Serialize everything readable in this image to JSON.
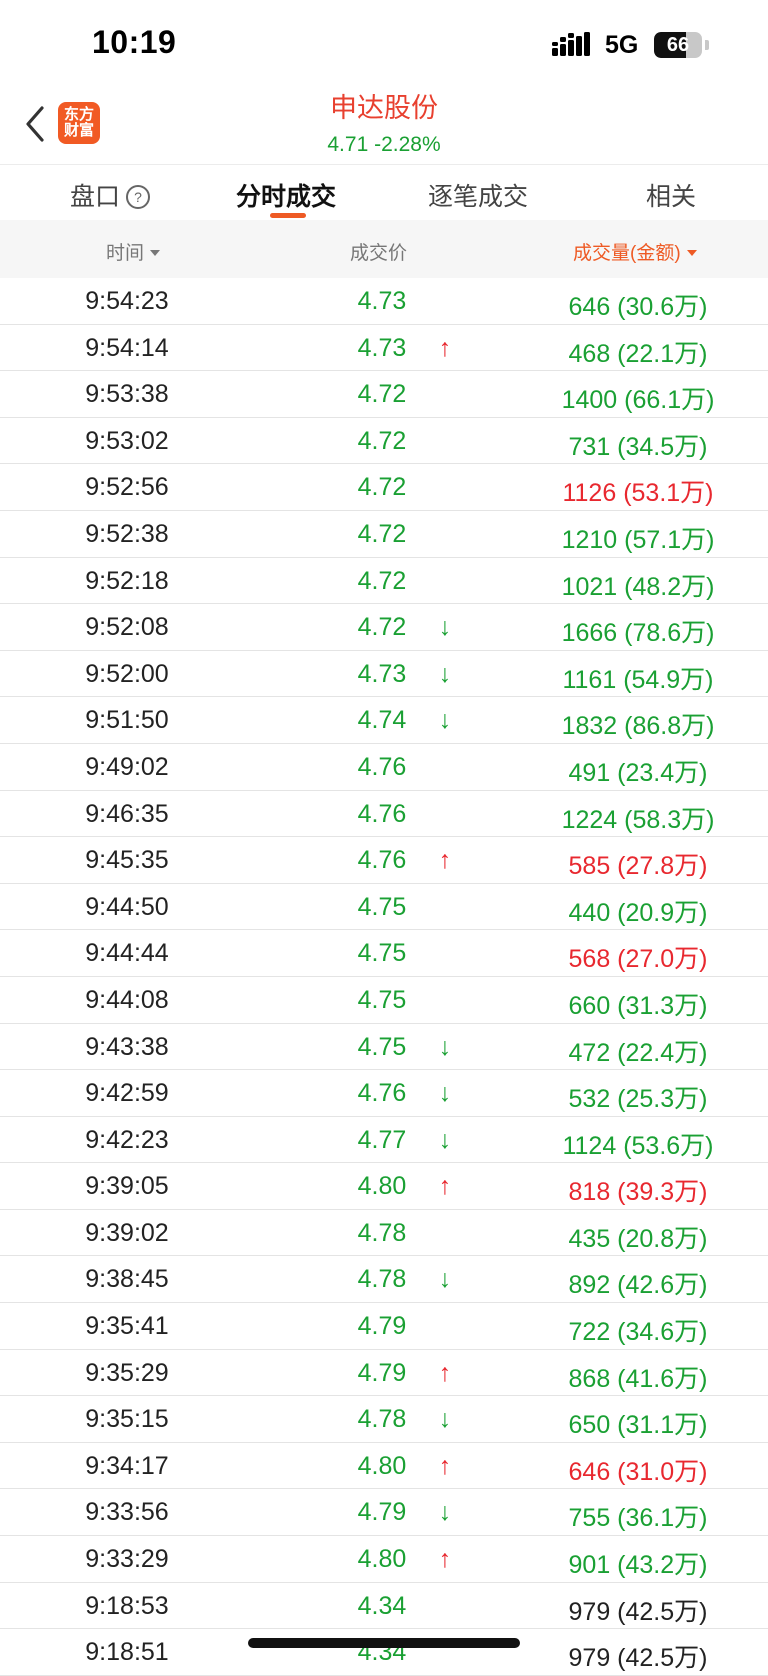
{
  "status": {
    "time": "10:19",
    "network": "5G",
    "battery": "66",
    "battery_level": 0.66
  },
  "header": {
    "logo_line1": "东方",
    "logo_line2": "财富",
    "stock_name": "申达股份",
    "quote": "4.71  -2.28%"
  },
  "tabs": [
    "盘口",
    "分时成交",
    "逐笔成交",
    "相关"
  ],
  "columns": {
    "time": "时间",
    "price": "成交价",
    "volume": "成交量(金额)"
  },
  "colors": {
    "up_red": "#e8282f",
    "down_green": "#1aa033",
    "accent": "#ee5a24"
  },
  "rows": [
    {
      "time": "9:54:23",
      "price": "4.73",
      "arrow": "",
      "volume": "646 (30.6万)",
      "color": "green"
    },
    {
      "time": "9:54:14",
      "price": "4.73",
      "arrow": "↑",
      "volume": "468 (22.1万)",
      "color": "green"
    },
    {
      "time": "9:53:38",
      "price": "4.72",
      "arrow": "",
      "volume": "1400 (66.1万)",
      "color": "green"
    },
    {
      "time": "9:53:02",
      "price": "4.72",
      "arrow": "",
      "volume": "731 (34.5万)",
      "color": "green"
    },
    {
      "time": "9:52:56",
      "price": "4.72",
      "arrow": "",
      "volume": "1126 (53.1万)",
      "color": "red"
    },
    {
      "time": "9:52:38",
      "price": "4.72",
      "arrow": "",
      "volume": "1210 (57.1万)",
      "color": "green"
    },
    {
      "time": "9:52:18",
      "price": "4.72",
      "arrow": "",
      "volume": "1021 (48.2万)",
      "color": "green"
    },
    {
      "time": "9:52:08",
      "price": "4.72",
      "arrow": "↓",
      "volume": "1666 (78.6万)",
      "color": "green"
    },
    {
      "time": "9:52:00",
      "price": "4.73",
      "arrow": "↓",
      "volume": "1161 (54.9万)",
      "color": "green"
    },
    {
      "time": "9:51:50",
      "price": "4.74",
      "arrow": "↓",
      "volume": "1832 (86.8万)",
      "color": "green"
    },
    {
      "time": "9:49:02",
      "price": "4.76",
      "arrow": "",
      "volume": "491 (23.4万)",
      "color": "green"
    },
    {
      "time": "9:46:35",
      "price": "4.76",
      "arrow": "",
      "volume": "1224 (58.3万)",
      "color": "green"
    },
    {
      "time": "9:45:35",
      "price": "4.76",
      "arrow": "↑",
      "volume": "585 (27.8万)",
      "color": "red"
    },
    {
      "time": "9:44:50",
      "price": "4.75",
      "arrow": "",
      "volume": "440 (20.9万)",
      "color": "green"
    },
    {
      "time": "9:44:44",
      "price": "4.75",
      "arrow": "",
      "volume": "568 (27.0万)",
      "color": "red"
    },
    {
      "time": "9:44:08",
      "price": "4.75",
      "arrow": "",
      "volume": "660 (31.3万)",
      "color": "green"
    },
    {
      "time": "9:43:38",
      "price": "4.75",
      "arrow": "↓",
      "volume": "472 (22.4万)",
      "color": "green"
    },
    {
      "time": "9:42:59",
      "price": "4.76",
      "arrow": "↓",
      "volume": "532 (25.3万)",
      "color": "green"
    },
    {
      "time": "9:42:23",
      "price": "4.77",
      "arrow": "↓",
      "volume": "1124 (53.6万)",
      "color": "green"
    },
    {
      "time": "9:39:05",
      "price": "4.80",
      "arrow": "↑",
      "volume": "818 (39.3万)",
      "color": "red"
    },
    {
      "time": "9:39:02",
      "price": "4.78",
      "arrow": "",
      "volume": "435 (20.8万)",
      "color": "green"
    },
    {
      "time": "9:38:45",
      "price": "4.78",
      "arrow": "↓",
      "volume": "892 (42.6万)",
      "color": "green"
    },
    {
      "time": "9:35:41",
      "price": "4.79",
      "arrow": "",
      "volume": "722 (34.6万)",
      "color": "green"
    },
    {
      "time": "9:35:29",
      "price": "4.79",
      "arrow": "↑",
      "volume": "868 (41.6万)",
      "color": "green"
    },
    {
      "time": "9:35:15",
      "price": "4.78",
      "arrow": "↓",
      "volume": "650 (31.1万)",
      "color": "green"
    },
    {
      "time": "9:34:17",
      "price": "4.80",
      "arrow": "↑",
      "volume": "646 (31.0万)",
      "color": "red"
    },
    {
      "time": "9:33:56",
      "price": "4.79",
      "arrow": "↓",
      "volume": "755 (36.1万)",
      "color": "green"
    },
    {
      "time": "9:33:29",
      "price": "4.80",
      "arrow": "↑",
      "volume": "901 (43.2万)",
      "color": "green"
    },
    {
      "time": "9:18:53",
      "price": "4.34",
      "arrow": "",
      "volume": "979 (42.5万)",
      "color": "black"
    },
    {
      "time": "9:18:51",
      "price": "4.34",
      "arrow": "",
      "volume": "979 (42.5万)",
      "color": "black"
    }
  ]
}
